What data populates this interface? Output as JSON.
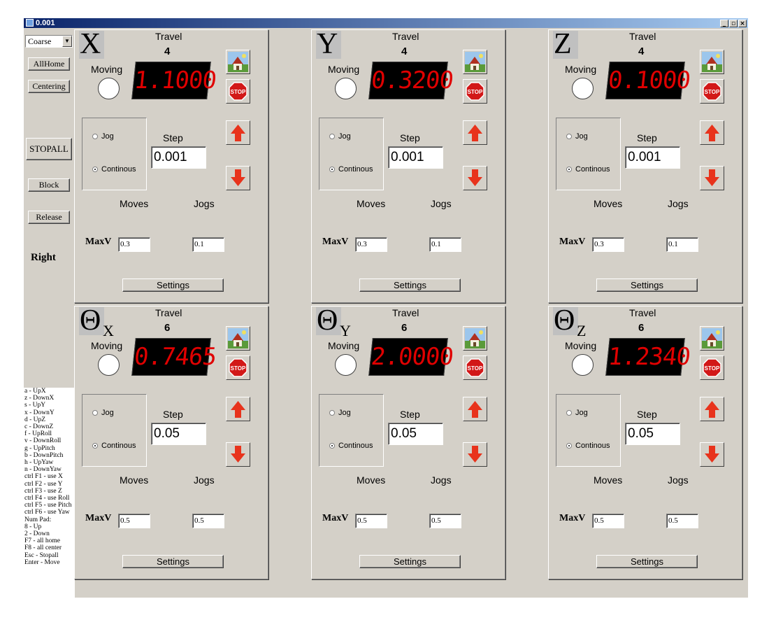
{
  "window": {
    "title": "0.001",
    "controls": [
      "_",
      "▫",
      "×"
    ]
  },
  "control": {
    "mode": "Coarse",
    "allhome": "AllHome",
    "centering": "Centering",
    "stopall": "STOPALL",
    "block": "Block",
    "release": "Release",
    "side": "Right"
  },
  "help": [
    "a - UpX",
    "z - DownX",
    "s - UpY",
    "x - DownY",
    "d - UpZ",
    "c - DownZ",
    "f - UpRoll",
    "v - DownRoll",
    "g - UpPitch",
    "b - DownPitch",
    "h - UpYaw",
    "n - DownYaw",
    "ctrl F1 - use X",
    "ctrl F2 - use Y",
    "ctrl F3 - use Z",
    "ctrl F4 - use Roll",
    "ctrl F5 - use Pitch",
    "ctrl F6 - use Yaw",
    "Num Pad:",
    "8 - Up",
    "2 - Down",
    "F7 - all home",
    "F8 - all center",
    "Esc - Stopall",
    "Enter - Move"
  ],
  "labels": {
    "travel": "Travel",
    "moving": "Moving",
    "jog": "Jog",
    "continous": "Continous",
    "step": "Step",
    "moves": "Moves",
    "jogs": "Jogs",
    "maxv": "MaxV",
    "settings": "Settings",
    "stop": "STOP"
  },
  "colors": {
    "accent_red": "#e8331c",
    "led_red": "#e00000"
  },
  "axes": [
    {
      "id": "x",
      "symbol": "X",
      "sub": "",
      "travel": "4",
      "position": "1.1000",
      "step": "0.001",
      "maxv": "0.3",
      "jogs": "0.1",
      "mode": "continous"
    },
    {
      "id": "y",
      "symbol": "Y",
      "sub": "",
      "travel": "4",
      "position": "0.3200",
      "step": "0.001",
      "maxv": "0.3",
      "jogs": "0.1",
      "mode": "continous"
    },
    {
      "id": "z",
      "symbol": "Z",
      "sub": "",
      "travel": "4",
      "position": "0.1000",
      "step": "0.001",
      "maxv": "0.3",
      "jogs": "0.1",
      "mode": "continous"
    },
    {
      "id": "theta-x",
      "symbol": "Θ",
      "sub": "X",
      "travel": "6",
      "position": "0.7465",
      "step": "0.05",
      "maxv": "0.5",
      "jogs": "0.5",
      "mode": "continous"
    },
    {
      "id": "theta-y",
      "symbol": "Θ",
      "sub": "Y",
      "travel": "6",
      "position": "2.0000",
      "step": "0.05",
      "maxv": "0.5",
      "jogs": "0.5",
      "mode": "continous"
    },
    {
      "id": "theta-z",
      "symbol": "Θ",
      "sub": "Z",
      "travel": "6",
      "position": "1.2340",
      "step": "0.05",
      "maxv": "0.5",
      "jogs": "0.5",
      "mode": "continous"
    }
  ]
}
